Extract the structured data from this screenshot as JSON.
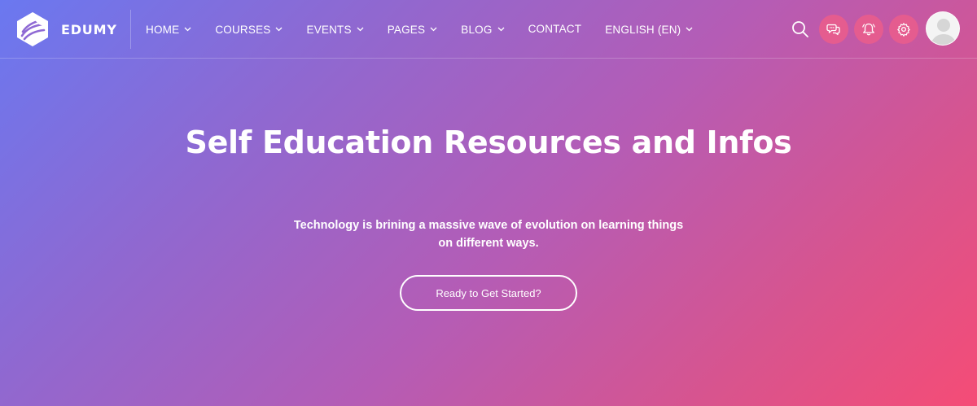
{
  "brand": {
    "name": "EDUMY",
    "logo_icon": "edumy-logo-icon"
  },
  "nav": {
    "items": [
      {
        "label": "HOME",
        "dropdown": true
      },
      {
        "label": "COURSES",
        "dropdown": true
      },
      {
        "label": "EVENTS",
        "dropdown": true
      },
      {
        "label": "PAGES",
        "dropdown": true
      },
      {
        "label": "BLOG",
        "dropdown": true
      },
      {
        "label": "CONTACT",
        "dropdown": false
      },
      {
        "label": "ENGLISH (EN)",
        "dropdown": true
      }
    ]
  },
  "header_actions": {
    "search_icon": "search-icon",
    "buttons": [
      {
        "icon": "chat-icon"
      },
      {
        "icon": "notification-bell-icon"
      },
      {
        "icon": "gear-icon"
      }
    ],
    "avatar_icon": "user-avatar"
  },
  "hero": {
    "title": "Self Education Resources and Infos",
    "subtitle": "Technology is brining a massive wave of evolution on learning things on different ways.",
    "cta_label": "Ready to Get Started?"
  },
  "colors": {
    "gradient_start": "#6a78f0",
    "gradient_mid": "#b55cb5",
    "gradient_end": "#f54c76",
    "action_button_bg": "#e55c8f",
    "text": "#ffffff"
  }
}
